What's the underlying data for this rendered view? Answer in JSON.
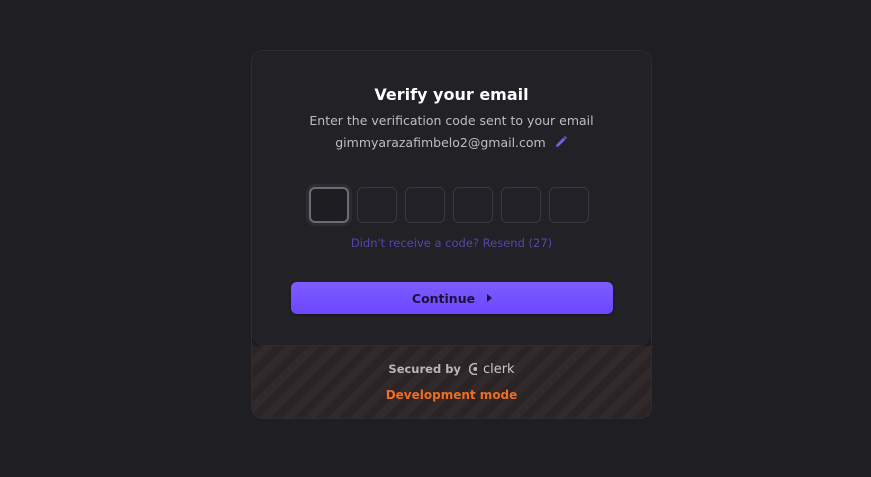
{
  "verify": {
    "title": "Verify your email",
    "subtitle": "Enter the verification code sent to your email",
    "email": "gimmyarazafimbelo2@gmail.com",
    "edit_icon": "pencil-icon",
    "otp_length": 6,
    "resend_text": "Didn't receive a code? Resend (27)",
    "continue_label": "Continue",
    "continue_icon": "triangle-right-icon"
  },
  "footer": {
    "secured_by": "Secured by",
    "brand": "clerk",
    "brand_icon": "clerk-logo-icon",
    "dev_mode": "Development mode"
  },
  "colors": {
    "background": "#1f1f23",
    "card": "#212126",
    "accent": "#6c47ff",
    "resend_link": "#5944a8",
    "dev_mode": "#ef6d20"
  }
}
